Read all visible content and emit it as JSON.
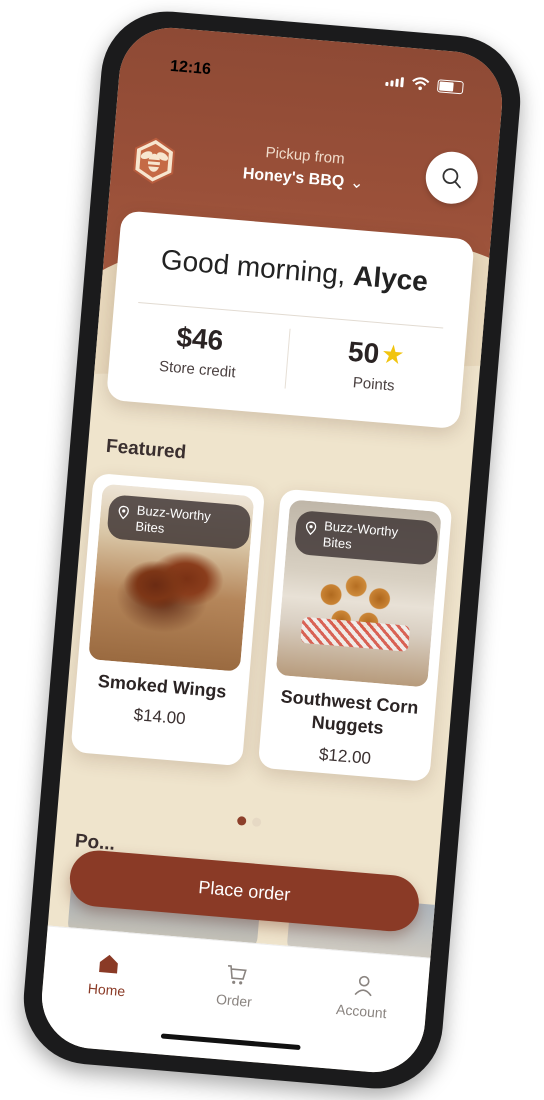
{
  "status_bar": {
    "time": "12:16"
  },
  "header": {
    "pickup_label": "Pickup from",
    "store_name": "Honey's BBQ",
    "store_chevron": "chevron-down-icon",
    "logo": "bee-logo",
    "search_icon": "search-icon"
  },
  "greeting": {
    "prefix": "Good morning,",
    "name": "Alyce",
    "store_credit_value": "$46",
    "store_credit_label": "Store credit",
    "points_value": "50",
    "points_label": "Points",
    "points_icon": "star-icon"
  },
  "featured": {
    "title": "Featured",
    "items": [
      {
        "tag": "Buzz-Worthy Bites",
        "name": "Smoked Wings",
        "price": "$14.00"
      },
      {
        "tag": "Buzz-Worthy Bites",
        "name": "Southwest Corn Nuggets",
        "price": "$12.00"
      }
    ],
    "carousel_page": 1,
    "carousel_total": 2
  },
  "popular": {
    "title": "Po..."
  },
  "cta": {
    "label": "Place order"
  },
  "tabs": [
    {
      "label": "Home",
      "icon": "home-icon",
      "active": true
    },
    {
      "label": "Order",
      "icon": "cart-icon",
      "active": false
    },
    {
      "label": "Account",
      "icon": "user-icon",
      "active": false
    }
  ],
  "colors": {
    "brand": "#8a3a26",
    "background": "#efe4cc",
    "star": "#f1c40f"
  }
}
